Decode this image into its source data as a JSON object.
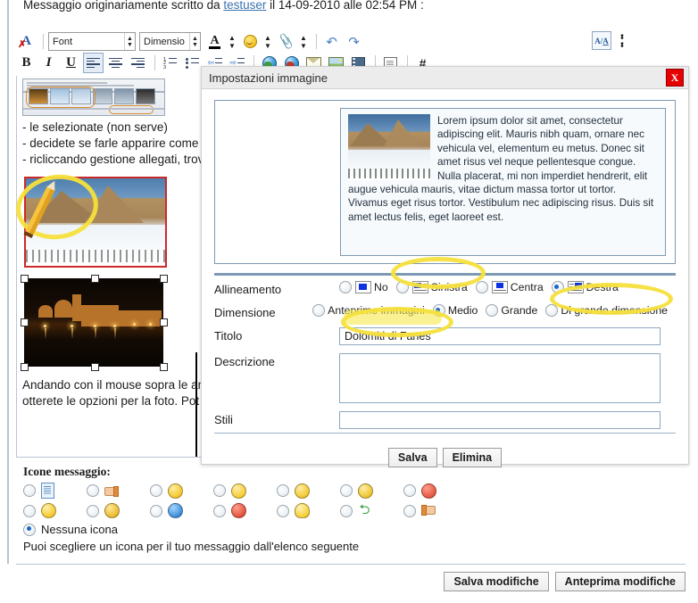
{
  "post": {
    "quote_prefix": "Messaggio originariamente scritto da ",
    "quote_user": "testuser",
    "quote_suffix": " il 14-09-2010 alle 02:54 PM :"
  },
  "toolbar": {
    "remove_format_icon": "remove-format-icon",
    "font_value": "Font",
    "size_value": "Dimensio",
    "font_color_icon": "font-color-icon",
    "smiley_icon": "smiley-icon",
    "attachment_icon": "paperclip-icon",
    "undo_icon": "undo-icon",
    "redo_icon": "redo-icon",
    "wysiwyg_icon": "toggle-wysiwyg-icon",
    "bold": "B",
    "italic": "I",
    "underline": "U",
    "align_left_icon": "align-left-icon",
    "align_center_icon": "align-center-icon",
    "align_right_icon": "align-right-icon",
    "ordered_list_icon": "ordered-list-icon",
    "unordered_list_icon": "unordered-list-icon",
    "outdent_icon": "outdent-icon",
    "indent_icon": "indent-icon",
    "link_icon": "insert-link-icon",
    "unlink_icon": "remove-link-icon",
    "email_icon": "insert-email-icon",
    "image_icon": "insert-image-icon",
    "video_icon": "insert-video-icon",
    "quote_icon": "insert-quote-icon",
    "code_icon": "insert-code-icon"
  },
  "editor": {
    "line1": "- le selezionate (non serve)",
    "line2": "- decidete se farle apparire come",
    "line3": "- ricliccando gestione allegati, trov",
    "line4": "Andando con il mouse sopra le an",
    "line5": "otterete le opzioni per la foto. Pot"
  },
  "dialog": {
    "title": "Impostazioni immagine",
    "close_label": "X",
    "preview_text": "Lorem ipsum dolor sit amet, consectetur adipiscing elit. Mauris nibh quam, ornare nec vehicula vel, elementum eu metus. Donec sit amet risus vel neque pellentesque congue. Nulla placerat, mi non imperdiet hendrerit, elit augue vehicula mauris, vitae dictum massa tortor ut tortor. Vivamus eget risus tortor. Vestibulum nec adipiscing risus. Duis sit amet lectus felis, eget laoreet est.",
    "fields": {
      "alignment_label": "Allineamento",
      "alignment_options": [
        {
          "label": "No",
          "selected": false
        },
        {
          "label": "Sinistra",
          "selected": false
        },
        {
          "label": "Centra",
          "selected": false
        },
        {
          "label": "Destra",
          "selected": true
        }
      ],
      "size_label": "Dimensione",
      "size_options": [
        {
          "label": "Anteprime immagini",
          "selected": false
        },
        {
          "label": "Medio",
          "selected": true
        },
        {
          "label": "Grande",
          "selected": false
        },
        {
          "label": "Di grande dimensione",
          "selected": false
        }
      ],
      "title_label": "Titolo",
      "title_value": "Dolomiti di Fanes",
      "description_label": "Descrizione",
      "description_value": "",
      "styles_label": "Stili",
      "styles_value": ""
    },
    "save_label": "Salva",
    "delete_label": "Elimina"
  },
  "message_icons": {
    "title": "Icone messaggio:",
    "help": "Puoi scegliere un icona per il tuo messaggio dall'elenco seguente",
    "none_label": "Nessuna icona",
    "none_selected": true,
    "row1": [
      {
        "name": "document-icon",
        "selected": false
      },
      {
        "name": "thumbs-down-icon",
        "selected": false
      },
      {
        "name": "grin-icon",
        "selected": false
      },
      {
        "name": "smile-icon",
        "selected": false
      },
      {
        "name": "big-grin-icon",
        "selected": false
      },
      {
        "name": "frown-icon",
        "selected": false
      },
      {
        "name": "angry-icon",
        "selected": false
      }
    ],
    "row2": [
      {
        "name": "wink-icon",
        "selected": false
      },
      {
        "name": "cool-icon",
        "selected": false
      },
      {
        "name": "question-icon",
        "selected": false
      },
      {
        "name": "exclamation-icon",
        "selected": false
      },
      {
        "name": "lightbulb-icon",
        "selected": false
      },
      {
        "name": "arrow-icon",
        "selected": false
      },
      {
        "name": "thumbs-up-icon",
        "selected": false
      }
    ]
  },
  "footer": {
    "save_changes_label": "Salva modifiche",
    "preview_changes_label": "Anteprima modifiche"
  },
  "colors": {
    "accent": "#3b73af",
    "highlighter": "#f5e03c",
    "close_red": "#e60000",
    "dialog_border": "#7d99b3"
  }
}
